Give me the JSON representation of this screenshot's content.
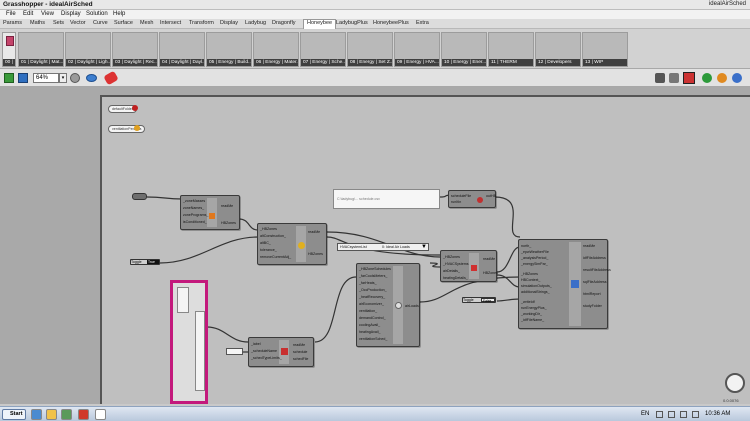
{
  "window": {
    "title": "Grasshopper - idealAirSched",
    "doc_name": "idealAirSched"
  },
  "menu": [
    "File",
    "Edit",
    "View",
    "Display",
    "Solution",
    "Help"
  ],
  "tabs": [
    "Params",
    "Maths",
    "Sets",
    "Vector",
    "Curve",
    "Surface",
    "Mesh",
    "Intersect",
    "Transform",
    "Display",
    "Ladybug",
    "Dragonfly",
    "Honeybee",
    "LadybugPlus",
    "HoneybeePlus",
    "Extra"
  ],
  "active_tab": "Honeybee",
  "ribbon": {
    "first_panel": "00 |",
    "panels": [
      "01 | Daylight | Mat...",
      "02 | Daylight | Ligh...",
      "03 | Daylight | Rec...",
      "04 | Daylight | Dayl...",
      "05 | Energy | Build...",
      "06 | Energy | Mater...",
      "07 | Energy | Sche...",
      "08 | Energy | Set Z...",
      "09 | Energy | HVA...",
      "10 | Energy | Ener...",
      "11 | THERM",
      "12 | Developers",
      "13 | WIP"
    ]
  },
  "toolbar": {
    "zoom": "64%"
  },
  "canvas": {
    "small_nodes": [
      "defaultFolder",
      "ventilationPerArea"
    ],
    "panel_text": "C:\\ladybug\\... schedule.csv",
    "hb_component_labels": [
      "_HBZones",
      "HBZones",
      "readMe"
    ],
    "toggles": [
      {
        "label": "Toggle",
        "value": "True"
      },
      {
        "label": "Toggle",
        "value": "False"
      }
    ],
    "dropdown": {
      "left": "HVACsystemList",
      "right": "0: Ideal Air Loads"
    },
    "status": "0.0.0076"
  },
  "taskbar": {
    "start": "Start",
    "lang": "EN",
    "clock": "10:36 AM"
  }
}
